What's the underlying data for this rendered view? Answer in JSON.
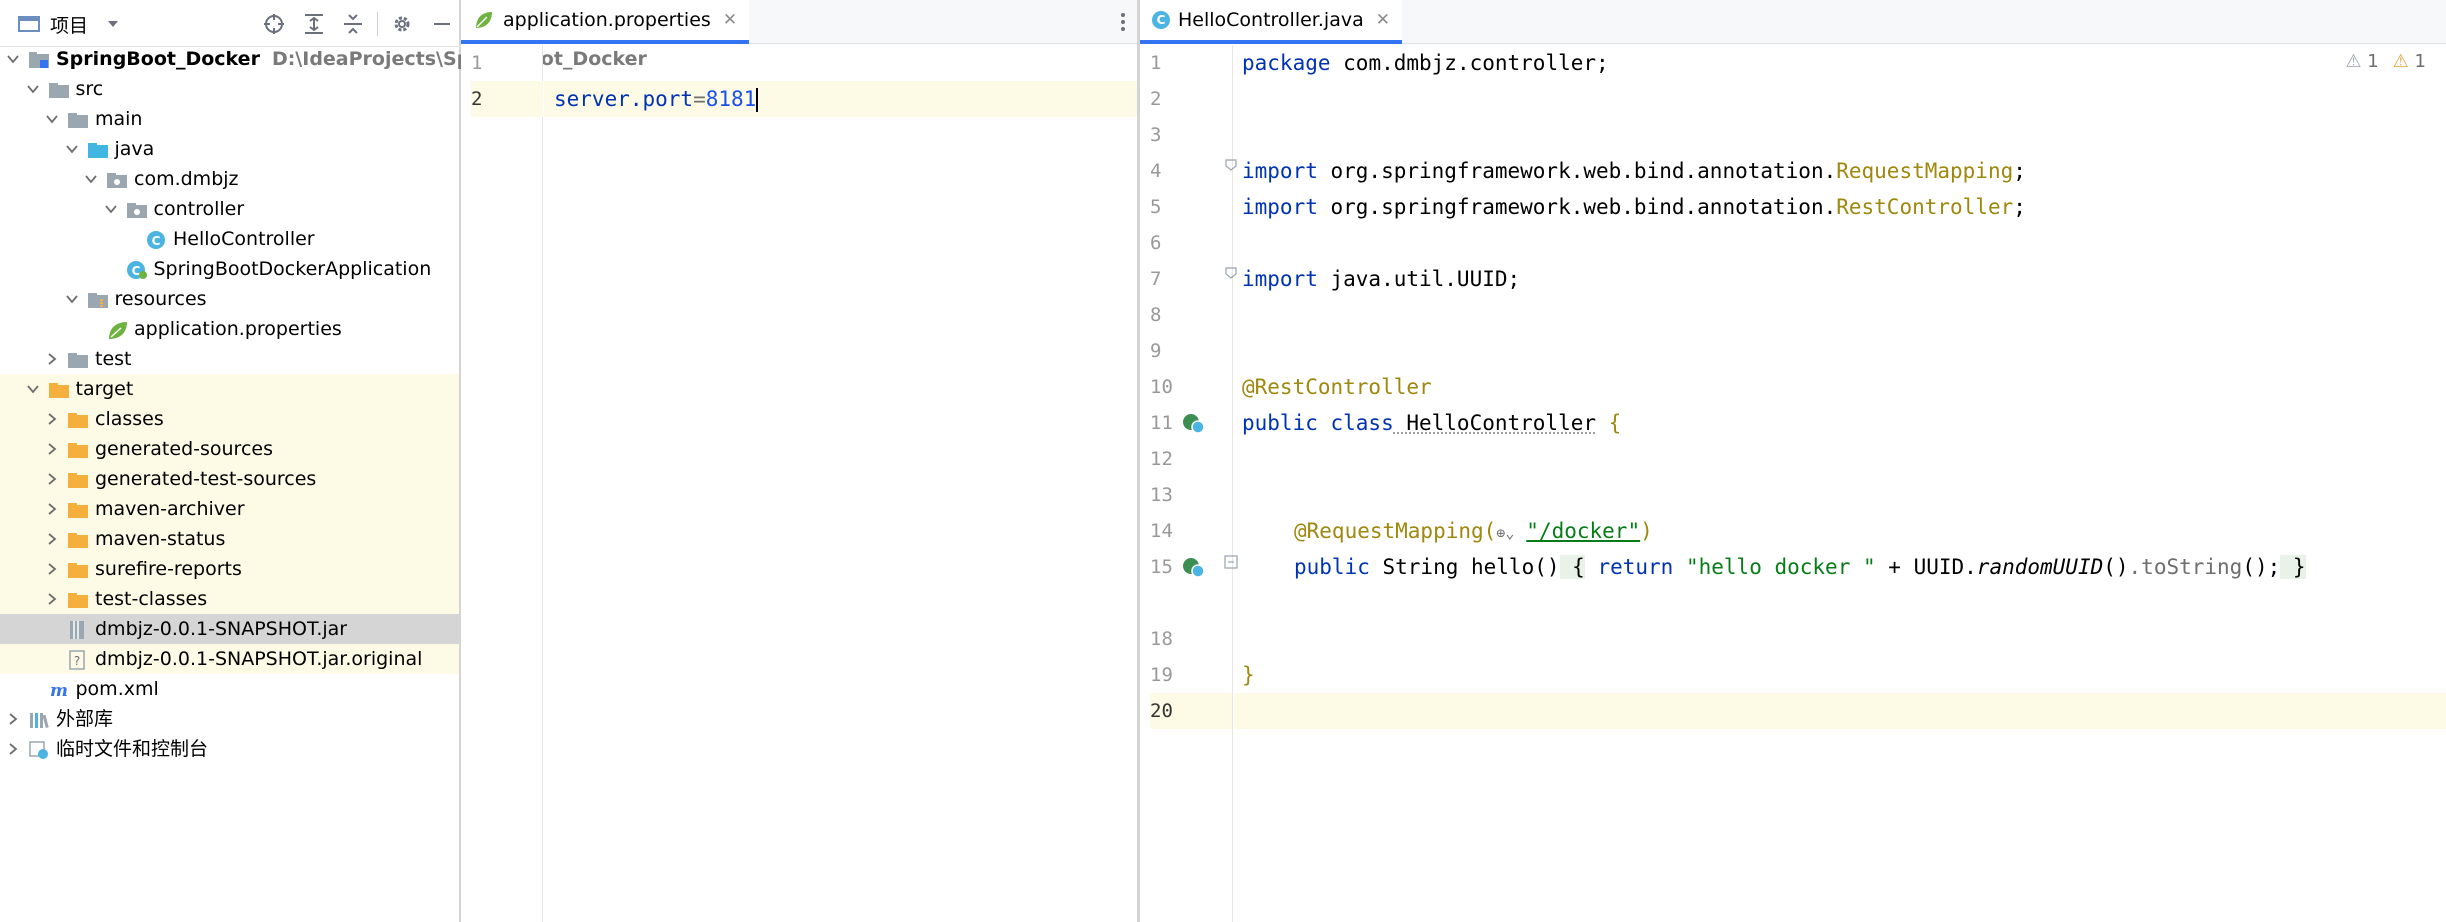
{
  "project_panel": {
    "title": "项目",
    "toolbar_icons": [
      "crosshair-icon",
      "expand-all-icon",
      "collapse-all-icon",
      "gear-icon",
      "minimize-icon"
    ],
    "tree": [
      {
        "name": "SpringBoot_Docker",
        "path": "D:\\IdeaProjects\\SpringBoot_Docker",
        "icon": "module-folder-icon",
        "expanded": true
      },
      {
        "name": "src",
        "icon": "folder-icon",
        "expanded": true
      },
      {
        "name": "main",
        "icon": "folder-icon",
        "expanded": true
      },
      {
        "name": "java",
        "icon": "source-folder-icon",
        "expanded": true
      },
      {
        "name": "com.dmbjz",
        "icon": "package-icon",
        "expanded": true
      },
      {
        "name": "controller",
        "icon": "package-icon",
        "expanded": true
      },
      {
        "name": "HelloController",
        "icon": "class-icon"
      },
      {
        "name": "SpringBootDockerApplication",
        "icon": "spring-boot-class-icon"
      },
      {
        "name": "resources",
        "icon": "resources-folder-icon",
        "expanded": true
      },
      {
        "name": "application.properties",
        "icon": "spring-properties-icon"
      },
      {
        "name": "test",
        "icon": "folder-icon",
        "expanded": false
      },
      {
        "name": "target",
        "icon": "excluded-folder-icon",
        "expanded": true
      },
      {
        "name": "classes",
        "icon": "excluded-folder-icon",
        "expanded": false
      },
      {
        "name": "generated-sources",
        "icon": "excluded-folder-icon",
        "expanded": false
      },
      {
        "name": "generated-test-sources",
        "icon": "excluded-folder-icon",
        "expanded": false
      },
      {
        "name": "maven-archiver",
        "icon": "excluded-folder-icon",
        "expanded": false
      },
      {
        "name": "maven-status",
        "icon": "excluded-folder-icon",
        "expanded": false
      },
      {
        "name": "surefire-reports",
        "icon": "excluded-folder-icon",
        "expanded": false
      },
      {
        "name": "test-classes",
        "icon": "excluded-folder-icon",
        "expanded": false
      },
      {
        "name": "dmbjz-0.0.1-SNAPSHOT.jar",
        "icon": "jar-icon",
        "selected": true
      },
      {
        "name": "dmbjz-0.0.1-SNAPSHOT.jar.original",
        "icon": "unknown-file-icon"
      },
      {
        "name": "pom.xml",
        "icon": "maven-icon"
      },
      {
        "name": "外部库",
        "icon": "libraries-icon",
        "expanded": false
      },
      {
        "name": "临时文件和控制台",
        "icon": "scratches-icon",
        "expanded": false
      }
    ]
  },
  "left_editor": {
    "tab": "application.properties",
    "line_numbers": [
      "1",
      "2"
    ],
    "lines": [
      {
        "key": "",
        "op": "",
        "value": ""
      },
      {
        "key": "server.port",
        "op": "=",
        "value": "8181"
      }
    ],
    "status_icon": "checkmark-icon"
  },
  "right_editor": {
    "tab": "HelloController.java",
    "inspections": {
      "weak_warnings": "1",
      "warnings": "1"
    },
    "line_numbers": [
      "1",
      "2",
      "3",
      "4",
      "5",
      "6",
      "7",
      "8",
      "9",
      "10",
      "11",
      "12",
      "13",
      "14",
      "15",
      "18",
      "19",
      "20"
    ],
    "code": {
      "l1_kw": "package",
      "l1_rest": " com.dmbjz.controller;",
      "l4_kw": "import",
      "l4_pkg": " org.springframework.web.bind.annotation.",
      "l4_cls": "RequestMapping",
      "l4_end": ";",
      "l5_kw": "import",
      "l5_pkg": " org.springframework.web.bind.annotation.",
      "l5_cls": "RestController",
      "l5_end": ";",
      "l7_kw": "import",
      "l7_rest": " java.util.UUID;",
      "l10_ann": "@RestController",
      "l11_kw": "public class",
      "l11_cls": " HelloController",
      "l11_brace": " {",
      "l14_ann": "@RequestMapping(",
      "l14_str": "\"/docker\"",
      "l14_end": ")",
      "l15_kw": "public",
      "l15_a": " String hello",
      "l15_paren": "()",
      "l15_ob": " {",
      "l15_ret": " return",
      "l15_str": " \"hello docker \"",
      "l15_plus": " + UUID.",
      "l15_method": "randomUUID",
      "l15_paren2": "()",
      "l15_tostr": ".toString",
      "l15_paren3": "();",
      "l15_cb": " }",
      "l19_brace": "}"
    }
  }
}
